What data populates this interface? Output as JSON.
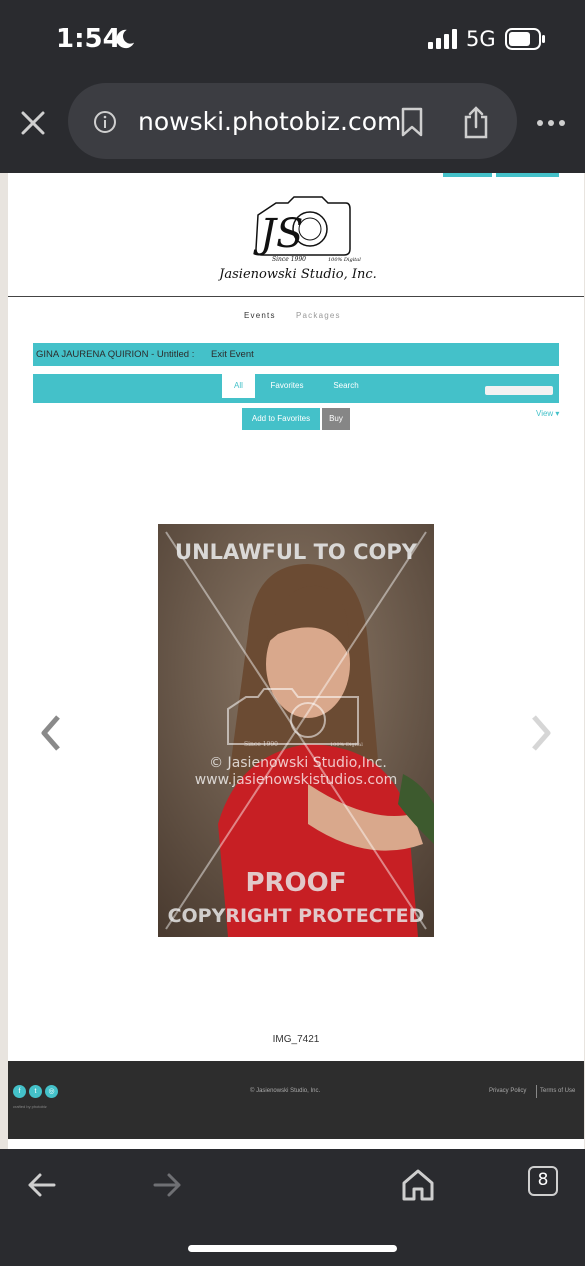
{
  "status_bar": {
    "time": "1:54",
    "network": "5G"
  },
  "browser": {
    "url": "nowski.photobiz.com",
    "tab_count": "8"
  },
  "site": {
    "logo": {
      "initials": "JS",
      "since": "Since 1990",
      "digital": "100% Digital",
      "name": "Jasienowski Studio, Inc."
    },
    "nav": {
      "events": "Events",
      "packages": "Packages"
    },
    "event": {
      "title": "GINA JAURENA QUIRION - Untitled :",
      "exit": "Exit Event"
    },
    "tabs": {
      "all": "All",
      "favorites": "Favorites",
      "search": "Search"
    },
    "view_label": "View ▾",
    "buttons": {
      "add_to_favorites": "Add to Favorites",
      "buy": "Buy"
    },
    "photo": {
      "watermark_top": "UNLAWFUL TO COPY",
      "watermark_copyright": "© Jasienowski Studio,Inc.",
      "watermark_url": "www.jasienowskistudios.com",
      "watermark_proof": "PROOF",
      "watermark_protected": "COPYRIGHT PROTECTED",
      "watermark_since": "Since 1990",
      "watermark_digital": "100% Digital"
    },
    "image_name": "IMG_7421",
    "footer": {
      "social": [
        "f",
        "t",
        "◎"
      ],
      "powered_by": "crafted by photobiz",
      "copyright": "© Jasienowski Studio, Inc.",
      "privacy": "Privacy Policy",
      "terms": "Terms of Use"
    },
    "accent_color": "#44c1c9"
  }
}
